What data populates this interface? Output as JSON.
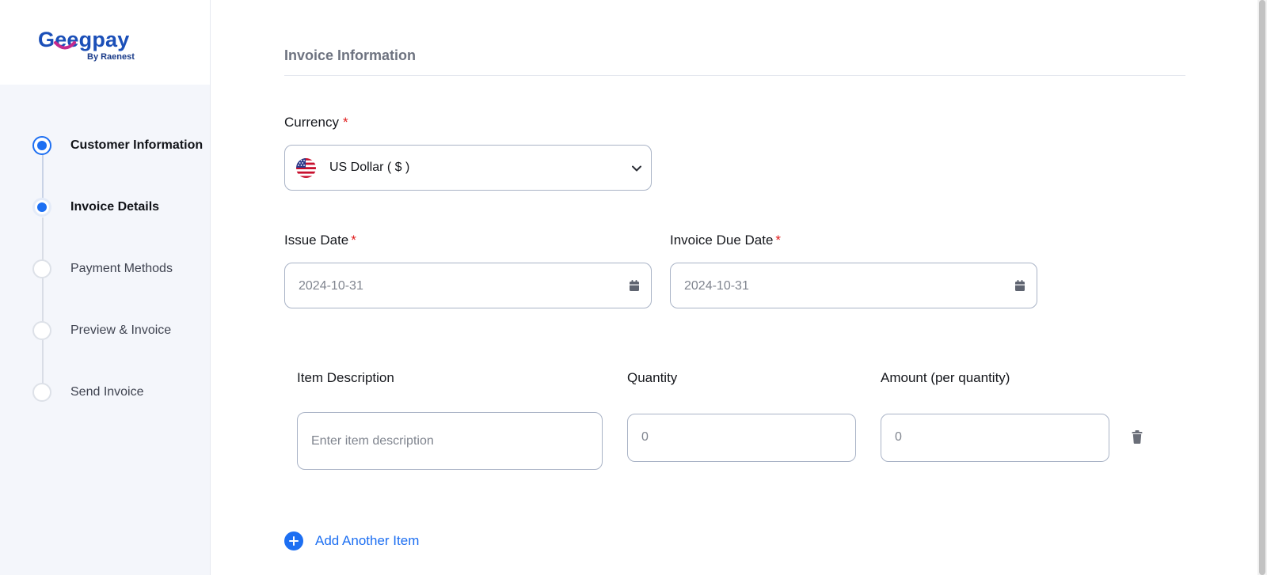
{
  "brand": {
    "name": "Geegpay",
    "tagline": "By Raenest",
    "colors": {
      "primary": "#1b4fb8",
      "accent": "#1d6ff2",
      "smile": "#c42a8e"
    }
  },
  "steps": [
    {
      "label": "Customer Information",
      "state": "completed"
    },
    {
      "label": "Invoice Details",
      "state": "active"
    },
    {
      "label": "Payment Methods",
      "state": "pending"
    },
    {
      "label": "Preview & Invoice",
      "state": "pending"
    },
    {
      "label": "Send Invoice",
      "state": "pending"
    }
  ],
  "form": {
    "section_title": "Invoice Information",
    "currency": {
      "label": "Currency",
      "required_mark": "*",
      "value": "US Dollar ( $ )",
      "flag_icon": "us-flag-icon"
    },
    "issue_date": {
      "label": "Issue Date",
      "required_mark": "*",
      "value": "2024-10-31"
    },
    "due_date": {
      "label": "Invoice Due Date",
      "required_mark": "*",
      "value": "2024-10-31"
    },
    "items": {
      "headers": {
        "description": "Item Description",
        "quantity": "Quantity",
        "amount": "Amount (per quantity)"
      },
      "rows": [
        {
          "description_placeholder": "Enter item description",
          "quantity_placeholder": "0",
          "amount_placeholder": "0"
        }
      ]
    },
    "add_item_label": "Add Another Item"
  }
}
